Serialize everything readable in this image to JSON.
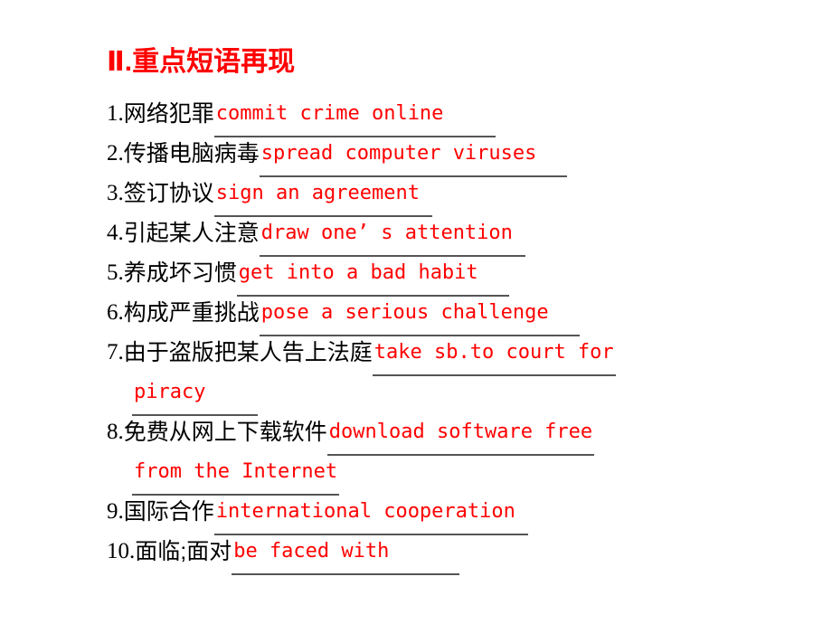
{
  "slide": {
    "title": "Ⅱ.重点短语再现",
    "title_color": "#ff0000",
    "chinese_color": "#000000",
    "answer_color": "#ff0000",
    "rule_color": "#555555",
    "background": "#ffffff"
  },
  "items": [
    {
      "num": "1.",
      "zh": "网络犯罪",
      "answer": "commit crime online",
      "answer_cont": ""
    },
    {
      "num": "2.",
      "zh": "传播电脑病毒",
      "answer": " spread computer viruses",
      "answer_cont": ""
    },
    {
      "num": "3.",
      "zh": "签订协议",
      "answer": " sign an agreement",
      "answer_cont": ""
    },
    {
      "num": "4.",
      "zh": "引起某人注意",
      "answer": "draw one’ s attention",
      "answer_cont": ""
    },
    {
      "num": "5.",
      "zh": "养成坏习惯",
      "answer": " get into a bad habit",
      "answer_cont": ""
    },
    {
      "num": "6.",
      "zh": "构成严重挑战",
      "answer": "pose a serious challenge",
      "answer_cont": ""
    },
    {
      "num": "7.",
      "zh": "由于盗版把某人告上法庭",
      "answer": "take sb.to court for",
      "answer_cont": " piracy"
    },
    {
      "num": "8.",
      "zh": "免费从网上下载软件",
      "answer": "download software free",
      "answer_cont": "from the Internet"
    },
    {
      "num": "9.",
      "zh": "国际合作",
      "answer": "international cooperation",
      "answer_cont": ""
    },
    {
      "num": "10.",
      "zh": "面临;面对",
      "answer": " be faced with",
      "answer_cont": ""
    }
  ]
}
